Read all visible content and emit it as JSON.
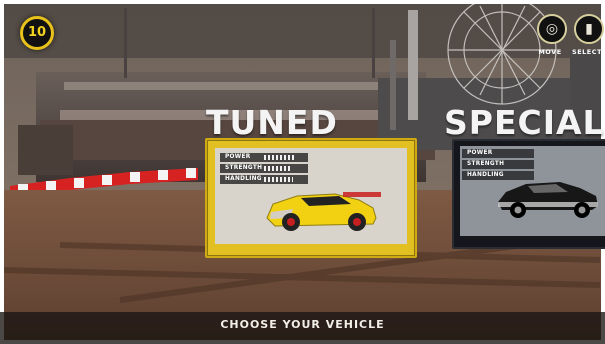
{
  "hud": {
    "timer": "10",
    "move_label": "MOVE",
    "select_label": "SELECT"
  },
  "vehicles": [
    {
      "category": "TUNED",
      "stats": {
        "power_label": "POWER",
        "strength_label": "STRENGTH",
        "handling_label": "HANDLING"
      },
      "stat_levels": [
        0.9,
        0.75,
        0.85
      ]
    },
    {
      "category": "SPECIAL",
      "stats": {
        "power_label": "POWER",
        "strength_label": "STRENGTH",
        "handling_label": "HANDLING"
      }
    }
  ],
  "footer": {
    "choose": "CHOOSE YOUR VEHICLE"
  },
  "colors": {
    "gold": "#e2c021",
    "hud_yellow": "#f1d21f"
  }
}
